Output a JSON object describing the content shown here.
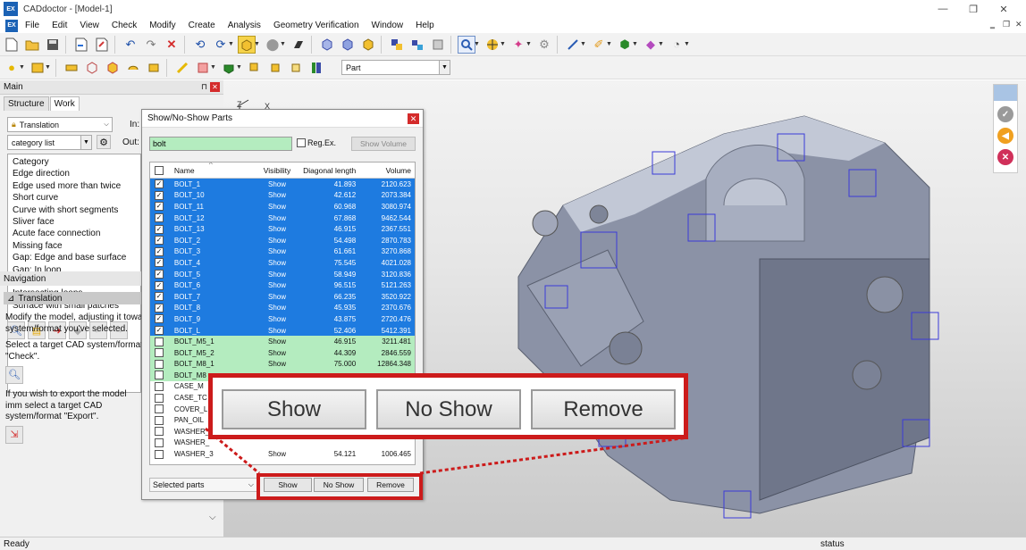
{
  "window": {
    "title": "CADdoctor - [Model-1]",
    "logo_text": "EX",
    "minimize": "—",
    "restore": "❐",
    "close": "✕"
  },
  "menu": [
    "File",
    "Edit",
    "View",
    "Check",
    "Modify",
    "Create",
    "Analysis",
    "Geometry Verification",
    "Window",
    "Help"
  ],
  "toolbar2": {
    "part_combo": "Part"
  },
  "main_panel": {
    "title": "Main",
    "tabs": [
      "Structure",
      "Work"
    ],
    "translation_combo": "Translation",
    "category_combo": "category list",
    "in_label": "In:",
    "out_label": "Out:",
    "check_items": [
      "Category",
      "Edge direction",
      "Edge used more than twice",
      "Short curve",
      "Curve with short segments",
      "Sliver face",
      "Acute face connection",
      "Missing face",
      "Gap: Edge and base surface",
      "Gap: In loop",
      "Loop with self-intersection",
      "Intersecting loops",
      "Surface with small patches"
    ]
  },
  "navigation": {
    "title": "Navigation",
    "section": "Translation",
    "para1": "Modify the model, adjusting it towa system/format you've selected.",
    "para2": "Select a target CAD system/format \"Check\".",
    "para3": "If you wish to export the model imm select a target CAD system/format \"Export\"."
  },
  "dialog": {
    "title": "Show/No-Show Parts",
    "search_value": "bolt",
    "regex_label": "Reg.Ex.",
    "show_volume": "Show Volume",
    "columns": {
      "name": "Name",
      "visibility": "Visibility",
      "diag": "Diagonal length",
      "volume": "Volume"
    },
    "rows": [
      {
        "name": "BOLT_1",
        "vis": "Show",
        "diag": "41.893",
        "vol": "2120.623",
        "state": "sel",
        "checked": true
      },
      {
        "name": "BOLT_10",
        "vis": "Show",
        "diag": "42.612",
        "vol": "2073.384",
        "state": "sel",
        "checked": true
      },
      {
        "name": "BOLT_11",
        "vis": "Show",
        "diag": "60.968",
        "vol": "3080.974",
        "state": "sel",
        "checked": true
      },
      {
        "name": "BOLT_12",
        "vis": "Show",
        "diag": "67.868",
        "vol": "9462.544",
        "state": "sel",
        "checked": true
      },
      {
        "name": "BOLT_13",
        "vis": "Show",
        "diag": "46.915",
        "vol": "2367.551",
        "state": "sel",
        "checked": true
      },
      {
        "name": "BOLT_2",
        "vis": "Show",
        "diag": "54.498",
        "vol": "2870.783",
        "state": "sel",
        "checked": true
      },
      {
        "name": "BOLT_3",
        "vis": "Show",
        "diag": "61.661",
        "vol": "3270.868",
        "state": "sel",
        "checked": true
      },
      {
        "name": "BOLT_4",
        "vis": "Show",
        "diag": "75.545",
        "vol": "4021.028",
        "state": "sel",
        "checked": true
      },
      {
        "name": "BOLT_5",
        "vis": "Show",
        "diag": "58.949",
        "vol": "3120.836",
        "state": "sel",
        "checked": true
      },
      {
        "name": "BOLT_6",
        "vis": "Show",
        "diag": "96.515",
        "vol": "5121.263",
        "state": "sel",
        "checked": true
      },
      {
        "name": "BOLT_7",
        "vis": "Show",
        "diag": "66.235",
        "vol": "3520.922",
        "state": "sel",
        "checked": true
      },
      {
        "name": "BOLT_8",
        "vis": "Show",
        "diag": "45.935",
        "vol": "2370.676",
        "state": "sel",
        "checked": true
      },
      {
        "name": "BOLT_9",
        "vis": "Show",
        "diag": "43.875",
        "vol": "2720.476",
        "state": "sel",
        "checked": true
      },
      {
        "name": "BOLT_L",
        "vis": "Show",
        "diag": "52.406",
        "vol": "5412.391",
        "state": "sel",
        "checked": true
      },
      {
        "name": "BOLT_M5_1",
        "vis": "Show",
        "diag": "46.915",
        "vol": "3211.481",
        "state": "hit",
        "checked": false
      },
      {
        "name": "BOLT_M5_2",
        "vis": "Show",
        "diag": "44.309",
        "vol": "2846.559",
        "state": "hit",
        "checked": false
      },
      {
        "name": "BOLT_M8_1",
        "vis": "Show",
        "diag": "75.000",
        "vol": "12864.348",
        "state": "hit",
        "checked": false
      },
      {
        "name": "BOLT_M8",
        "vis": "",
        "diag": "",
        "vol": "",
        "state": "hit",
        "checked": false
      },
      {
        "name": "CASE_M",
        "vis": "",
        "diag": "",
        "vol": "",
        "state": "",
        "checked": false
      },
      {
        "name": "CASE_TC",
        "vis": "",
        "diag": "",
        "vol": "",
        "state": "",
        "checked": false
      },
      {
        "name": "COVER_L",
        "vis": "",
        "diag": "",
        "vol": "",
        "state": "",
        "checked": false
      },
      {
        "name": "PAN_OIL",
        "vis": "",
        "diag": "",
        "vol": "",
        "state": "",
        "checked": false
      },
      {
        "name": "WASHER_",
        "vis": "",
        "diag": "",
        "vol": "",
        "state": "",
        "checked": false
      },
      {
        "name": "WASHER_",
        "vis": "",
        "diag": "",
        "vol": "",
        "state": "",
        "checked": false
      },
      {
        "name": "WASHER_3",
        "vis": "Show",
        "diag": "54.121",
        "vol": "1006.465",
        "state": "",
        "checked": false
      }
    ],
    "scope": "Selected parts",
    "show_btn": "Show",
    "noshow_btn": "No Show",
    "remove_btn": "Remove"
  },
  "zoom": {
    "show": "Show",
    "noshow": "No Show",
    "remove": "Remove"
  },
  "status": {
    "left": "Ready",
    "right": "status"
  },
  "colors": {
    "selection": "#1e7be0",
    "match": "#b4ecbf",
    "callout": "#cc1b1b"
  }
}
